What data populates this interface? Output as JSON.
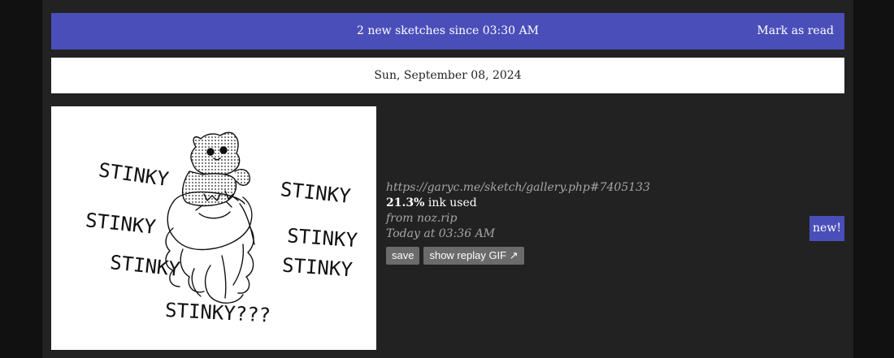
{
  "banner": {
    "message": "2 new sketches since 03:30 AM",
    "mark_read_label": "Mark as read"
  },
  "date_header": "Sun, September 08, 2024",
  "sketch": {
    "words": [
      "STINKY",
      "STINKY",
      "STINKY",
      "STINKY",
      "STINKY",
      "STINKY",
      "STINKY???"
    ],
    "url": "https://garyc.me/sketch/gallery.php#7405133",
    "ink_value": "21.3%",
    "ink_suffix": " ink used",
    "from": "from noz.rip",
    "time": "Today at 03:36 AM",
    "save_label": "save",
    "replay_label": "show replay GIF ↗",
    "badge": "new!"
  },
  "colors": {
    "accent": "#4a4eb9",
    "background": "#222222",
    "button": "#6b6b6b",
    "muted_text": "#a6a6a6"
  }
}
